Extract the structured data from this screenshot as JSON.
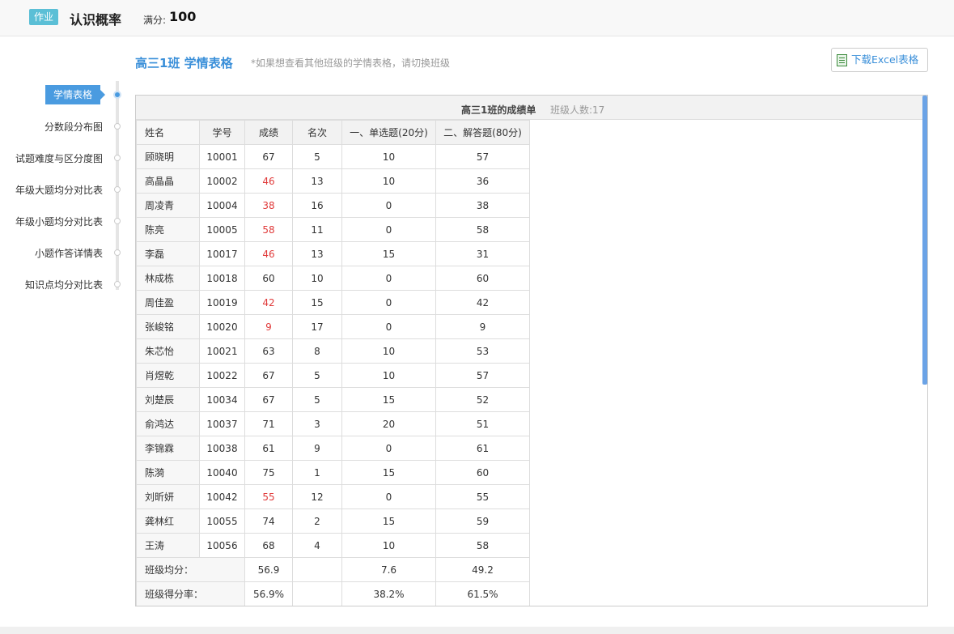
{
  "header": {
    "badge": "作业",
    "title": "认识概率",
    "score_label": "满分:",
    "score_value": "100"
  },
  "main": {
    "class_title": "高三1班 学情表格",
    "hint": "*如果想查看其他班级的学情表格，请切换班级",
    "download_label": "下载Excel表格"
  },
  "sidebar": {
    "items": [
      {
        "label": "学情表格",
        "active": true
      },
      {
        "label": "分数段分布图",
        "active": false
      },
      {
        "label": "试题难度与区分度图",
        "active": false
      },
      {
        "label": "年级大题均分对比表",
        "active": false
      },
      {
        "label": "年级小题均分对比表",
        "active": false
      },
      {
        "label": "小题作答详情表",
        "active": false
      },
      {
        "label": "知识点均分对比表",
        "active": false
      }
    ]
  },
  "table": {
    "title": "高三1班的成绩单",
    "count": "班级人数:17",
    "headers": [
      "姓名",
      "学号",
      "成绩",
      "名次",
      "一、单选题(20分)",
      "二、解答题(80分)"
    ],
    "fail_color": "#e03a3a",
    "rows": [
      [
        "顾晓明",
        "10001",
        "67",
        "5",
        "10",
        "57"
      ],
      [
        "高晶晶",
        "10002",
        "46",
        "13",
        "10",
        "36"
      ],
      [
        "周凌青",
        "10004",
        "38",
        "16",
        "0",
        "38"
      ],
      [
        "陈亮",
        "10005",
        "58",
        "11",
        "0",
        "58"
      ],
      [
        "李磊",
        "10017",
        "46",
        "13",
        "15",
        "31"
      ],
      [
        "林成栋",
        "10018",
        "60",
        "10",
        "0",
        "60"
      ],
      [
        "周佳盈",
        "10019",
        "42",
        "15",
        "0",
        "42"
      ],
      [
        "张峻铭",
        "10020",
        "9",
        "17",
        "0",
        "9"
      ],
      [
        "朱芯怡",
        "10021",
        "63",
        "8",
        "10",
        "53"
      ],
      [
        "肖煜乾",
        "10022",
        "67",
        "5",
        "10",
        "57"
      ],
      [
        "刘楚辰",
        "10034",
        "67",
        "5",
        "15",
        "52"
      ],
      [
        "俞鸿达",
        "10037",
        "71",
        "3",
        "20",
        "51"
      ],
      [
        "李锦霖",
        "10038",
        "61",
        "9",
        "0",
        "61"
      ],
      [
        "陈漪",
        "10040",
        "75",
        "1",
        "15",
        "60"
      ],
      [
        "刘昕妍",
        "10042",
        "55",
        "12",
        "0",
        "55"
      ],
      [
        "龚林红",
        "10055",
        "74",
        "2",
        "15",
        "59"
      ],
      [
        "王涛",
        "10056",
        "68",
        "4",
        "10",
        "58"
      ]
    ],
    "footer": [
      {
        "label": "班级均分：",
        "score": "56.9",
        "rank": "",
        "q1": "7.6",
        "q2": "49.2"
      },
      {
        "label": "班级得分率：",
        "score": "56.9%",
        "rank": "",
        "q1": "38.2%",
        "q2": "61.5%"
      }
    ]
  }
}
